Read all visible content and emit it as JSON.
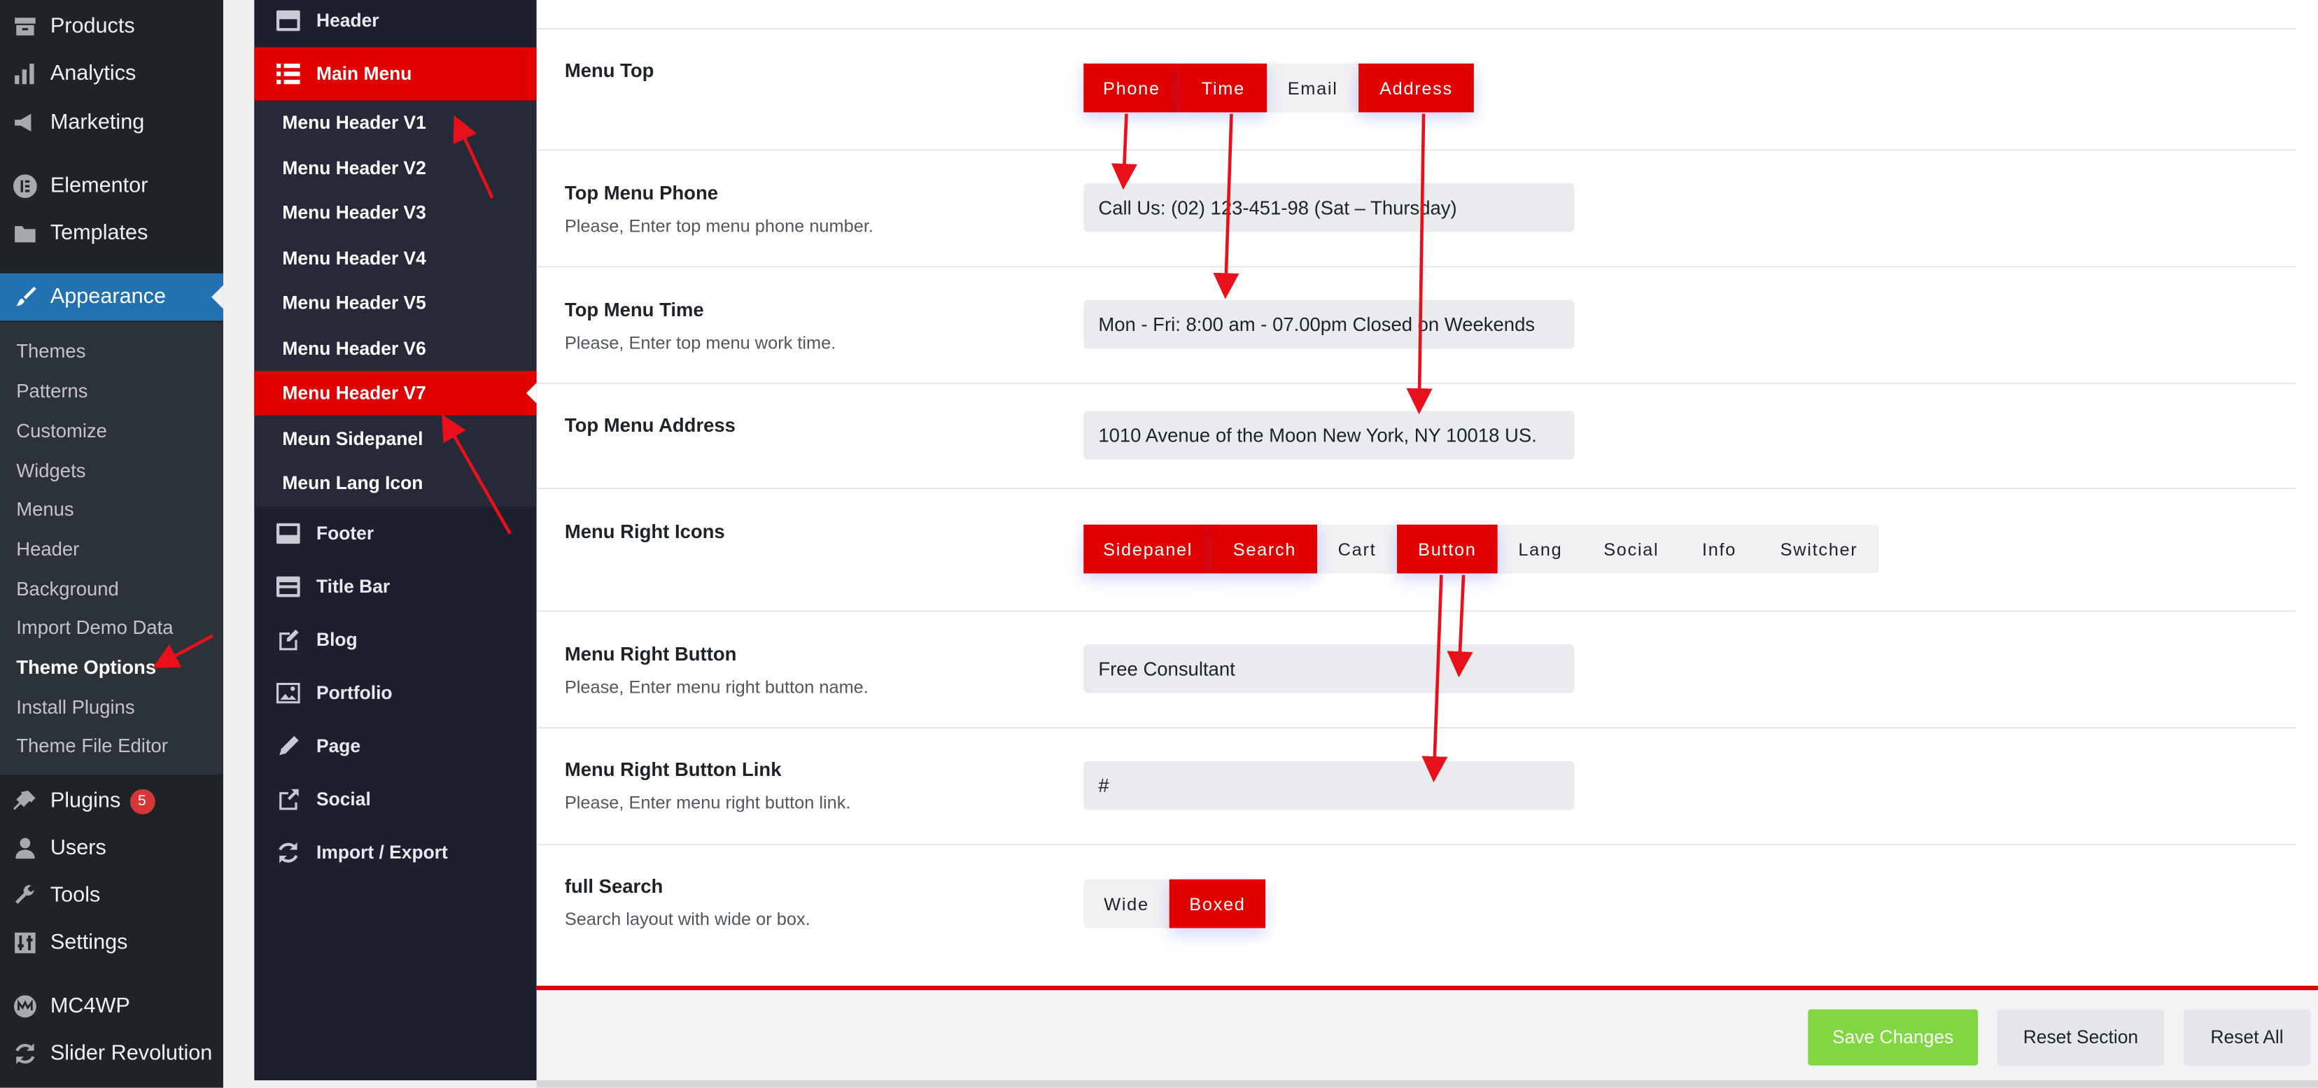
{
  "wp_menu": {
    "items": [
      {
        "label": "Products",
        "icon": "archive-icon"
      },
      {
        "label": "Analytics",
        "icon": "bar-chart-icon"
      },
      {
        "label": "Marketing",
        "icon": "megaphone-icon"
      },
      {
        "label": "Elementor",
        "icon": "elementor-icon"
      },
      {
        "label": "Templates",
        "icon": "folder-icon"
      },
      {
        "label": "Appearance",
        "icon": "paintbrush-icon"
      },
      {
        "label": "Plugins",
        "icon": "plug-icon",
        "badge": "5"
      },
      {
        "label": "Users",
        "icon": "user-icon"
      },
      {
        "label": "Tools",
        "icon": "wrench-icon"
      },
      {
        "label": "Settings",
        "icon": "settings-icon"
      },
      {
        "label": "MC4WP",
        "icon": "mc4wp-icon"
      },
      {
        "label": "Slider Revolution",
        "icon": "refresh-icon"
      }
    ],
    "appearance_sub": [
      "Themes",
      "Patterns",
      "Customize",
      "Widgets",
      "Menus",
      "Header",
      "Background",
      "Import Demo Data",
      "Theme Options",
      "Install Plugins",
      "Theme File Editor"
    ]
  },
  "options_nav": {
    "items": [
      {
        "label": "Header",
        "icon": "layout-header-icon"
      },
      {
        "label": "Main Menu",
        "icon": "list-icon"
      },
      {
        "label": "Footer",
        "icon": "layout-footer-icon"
      },
      {
        "label": "Title Bar",
        "icon": "title-bar-icon"
      },
      {
        "label": "Blog",
        "icon": "edit-icon"
      },
      {
        "label": "Portfolio",
        "icon": "image-icon"
      },
      {
        "label": "Page",
        "icon": "pencil-icon"
      },
      {
        "label": "Social",
        "icon": "share-icon"
      },
      {
        "label": "Import / Export",
        "icon": "refresh-icon"
      }
    ],
    "sub": [
      "Menu Header V1",
      "Menu Header V2",
      "Menu Header V3",
      "Menu Header V4",
      "Menu Header V5",
      "Menu Header V6",
      "Menu Header V7",
      "Meun Sidepanel",
      "Meun Lang Icon"
    ]
  },
  "fields": {
    "menu_top": {
      "title": "Menu Top",
      "options": [
        "Phone",
        "Time",
        "Email",
        "Address"
      ],
      "selected": [
        "Phone",
        "Time",
        "Address"
      ]
    },
    "top_phone": {
      "title": "Top Menu Phone",
      "desc": "Please, Enter top menu phone number.",
      "value": "Call Us: (02) 123-451-98 (Sat – Thursday)"
    },
    "top_time": {
      "title": "Top Menu Time",
      "desc": "Please, Enter top menu work time.",
      "value": "Mon - Fri: 8:00 am - 07.00pm Closed on Weekends"
    },
    "top_address": {
      "title": "Top Menu Address",
      "value": "1010 Avenue of the Moon New York, NY 10018 US."
    },
    "right_icons": {
      "title": "Menu Right Icons",
      "options": [
        "Sidepanel",
        "Search",
        "Cart",
        "Button",
        "Lang",
        "Social",
        "Info",
        "Switcher"
      ],
      "selected": [
        "Sidepanel",
        "Search",
        "Button"
      ]
    },
    "right_button": {
      "title": "Menu Right Button",
      "desc": "Please, Enter menu right button name.",
      "value": "Free Consultant"
    },
    "right_button_link": {
      "title": "Menu Right Button Link",
      "desc": "Please, Enter menu right button link.",
      "value": "#"
    },
    "full_search": {
      "title": "full Search",
      "desc": "Search layout with wide or box.",
      "options": [
        "Wide",
        "Boxed"
      ],
      "selected": [
        "Boxed"
      ]
    }
  },
  "footer": {
    "save": "Save Changes",
    "reset_section": "Reset Section",
    "reset_all": "Reset All"
  },
  "colors": {
    "accent_red": "#e00000",
    "wp_blue": "#2271b1",
    "save_green": "#81d742"
  }
}
